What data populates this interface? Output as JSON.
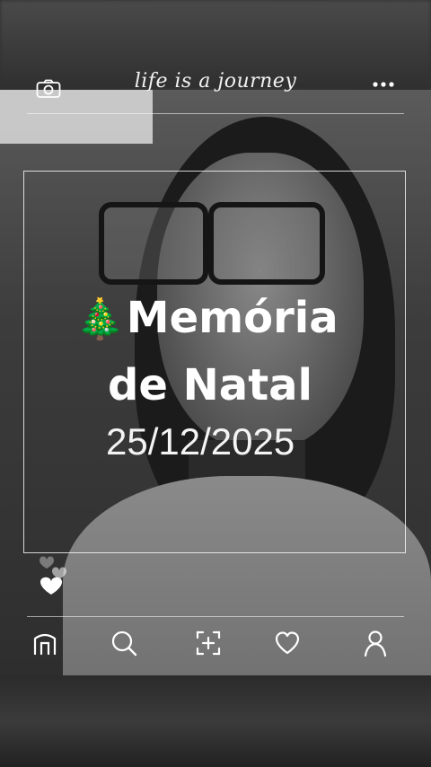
{
  "header": {
    "caption": "life is a journey",
    "left_icon": "camera-icon",
    "right_icon": "more-options-icon"
  },
  "post": {
    "title_emoji": "🎄",
    "title_line1": "Memória",
    "title_line2": "de Natal",
    "date": "25/12/2025"
  },
  "reactions": {
    "icon": "hearts-icon"
  },
  "bottom_nav": {
    "items": [
      {
        "name": "home",
        "icon": "home-icon"
      },
      {
        "name": "search",
        "icon": "search-icon"
      },
      {
        "name": "add",
        "icon": "add-post-icon"
      },
      {
        "name": "likes",
        "icon": "heart-icon"
      },
      {
        "name": "profile",
        "icon": "profile-icon"
      }
    ]
  },
  "colors": {
    "overlay_text": "#ffffff",
    "frame_line": "#ffffff"
  }
}
